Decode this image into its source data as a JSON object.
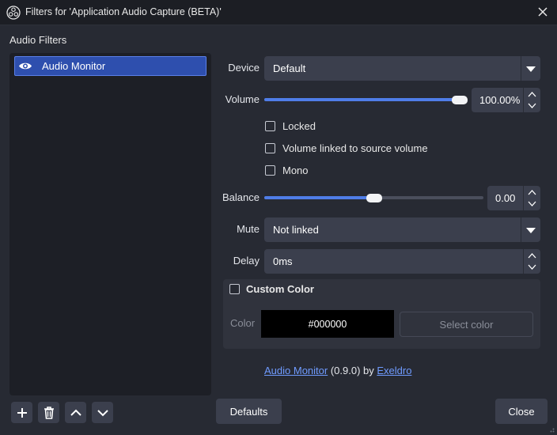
{
  "window": {
    "title": "Filters for 'Application Audio Capture (BETA)'",
    "app_icon": "obs-logo-icon",
    "close_icon": "close-icon"
  },
  "sidebar": {
    "section_label": "Audio Filters",
    "filters": [
      {
        "label": "Audio Monitor",
        "icon": "eye-icon",
        "selected": true,
        "visible": true
      }
    ],
    "buttons": [
      {
        "name": "add-filter-button",
        "icon": "plus-icon"
      },
      {
        "name": "remove-filter-button",
        "icon": "trash-icon"
      },
      {
        "name": "move-up-button",
        "icon": "chevron-up-icon"
      },
      {
        "name": "move-down-button",
        "icon": "chevron-down-icon"
      }
    ]
  },
  "properties": {
    "device": {
      "label": "Device",
      "value": "Default"
    },
    "volume": {
      "label": "Volume",
      "value": "100.00%",
      "level": 1.0
    },
    "checks": [
      {
        "label": "Locked",
        "checked": false
      },
      {
        "label": "Volume linked to source volume",
        "checked": false
      },
      {
        "label": "Mono",
        "checked": false
      }
    ],
    "balance": {
      "label": "Balance",
      "value": "0.00",
      "level": 0.5
    },
    "mute": {
      "label": "Mute",
      "value": "Not linked"
    },
    "delay": {
      "label": "Delay",
      "value": "0ms"
    },
    "custom_color": {
      "label": "Custom Color",
      "checked": false,
      "color_label": "Color",
      "color_value": "#000000",
      "select_button": "Select color"
    },
    "credit": {
      "plugin_link": "Audio Monitor",
      "version": " (0.9.0) by ",
      "author_link": "Exeldro"
    }
  },
  "footer": {
    "defaults_label": "Defaults",
    "close_label": "Close"
  },
  "colors": {
    "accent": "#4f7de8",
    "selection": "#2e4fae",
    "link": "#6f9bff",
    "background": "#272a33"
  }
}
